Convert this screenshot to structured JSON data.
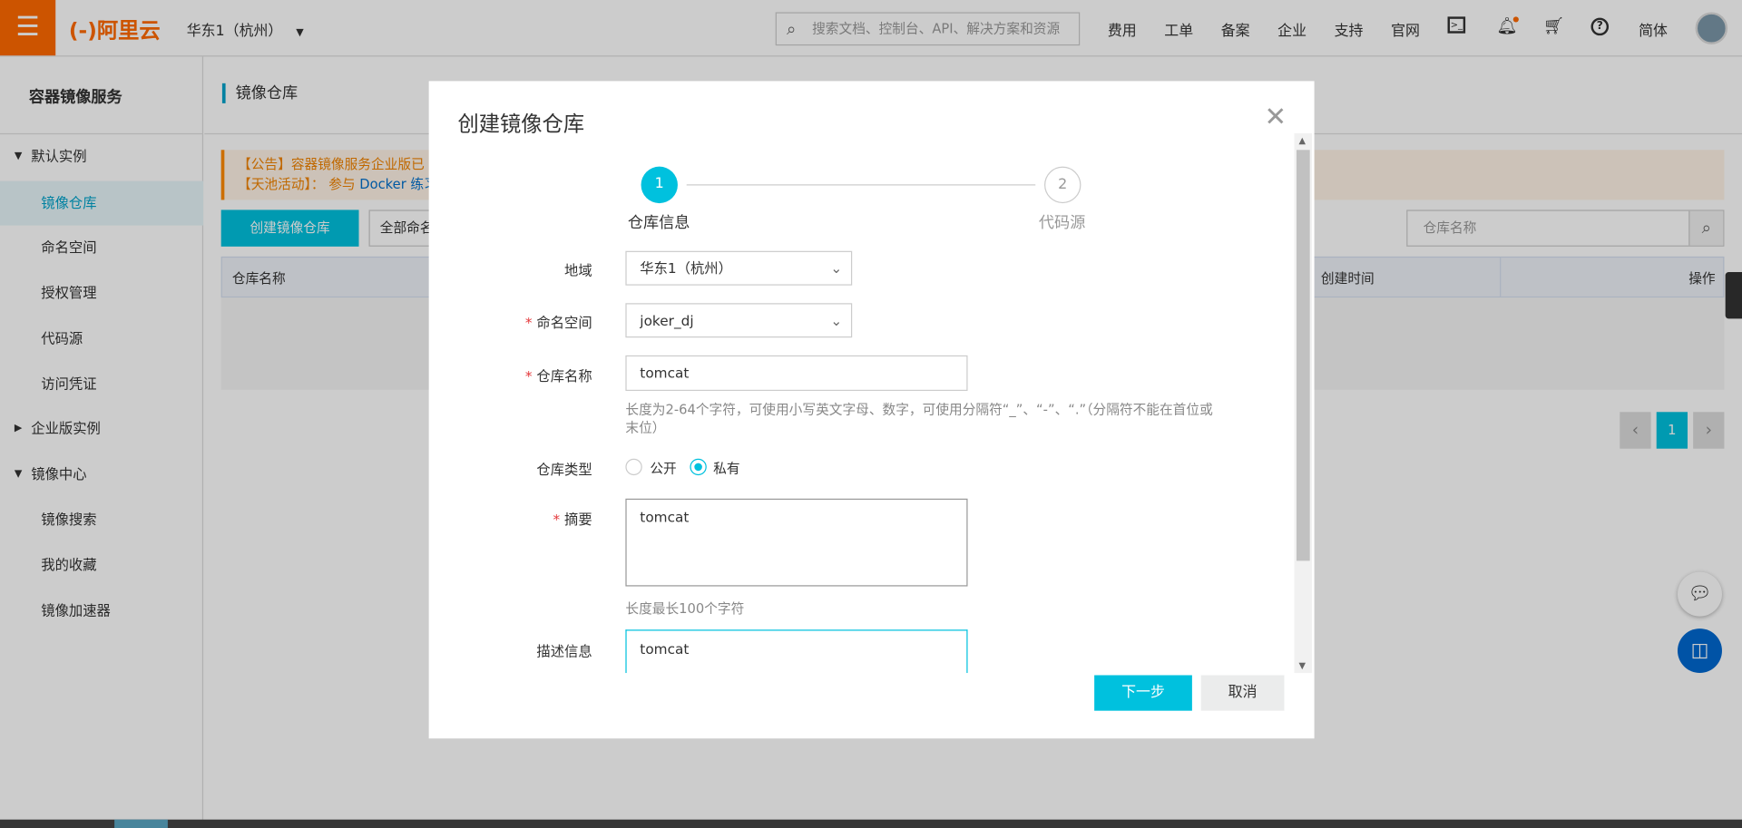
{
  "topbar": {
    "menu_icon": "hamburger-icon",
    "logo": "阿里云",
    "region": "华东1（杭州）",
    "search_placeholder": "搜索文档、控制台、API、解决方案和资源",
    "nav": [
      "费用",
      "工单",
      "备案",
      "企业",
      "支持",
      "官网"
    ],
    "language": "简体",
    "brand_color": "#ff6a00"
  },
  "sidebar": {
    "title": "容器镜像服务",
    "items": [
      {
        "label": "默认实例",
        "type": "group",
        "expanded": true
      },
      {
        "label": "镜像仓库",
        "active": true
      },
      {
        "label": "命名空间"
      },
      {
        "label": "授权管理"
      },
      {
        "label": "代码源"
      },
      {
        "label": "访问凭证"
      },
      {
        "label": "企业版实例",
        "type": "group",
        "expanded": false
      },
      {
        "label": "镜像中心",
        "type": "group",
        "expanded": true
      },
      {
        "label": "镜像搜索"
      },
      {
        "label": "我的收藏"
      },
      {
        "label": "镜像加速器"
      }
    ]
  },
  "main": {
    "title": "镜像仓库",
    "notice1": "【公告】容器镜像服务企业版已",
    "notice2_prefix": "【天池活动】： 参与 ",
    "notice2_link": "Docker 练习",
    "create_button": "创建镜像仓库",
    "namespace_filter": "全部命名",
    "search_placeholder": "仓库名称",
    "columns": [
      "仓库名称",
      "创建时间",
      "操作"
    ],
    "page": "1"
  },
  "modal": {
    "title": "创建镜像仓库",
    "steps": [
      {
        "num": "1",
        "label": "仓库信息",
        "active": true
      },
      {
        "num": "2",
        "label": "代码源",
        "active": false
      }
    ],
    "fields": {
      "region_label": "地域",
      "region_value": "华东1（杭州）",
      "namespace_label": "命名空间",
      "namespace_value": "joker_dj",
      "name_label": "仓库名称",
      "name_value": "tomcat",
      "name_help": "长度为2-64个字符，可使用小写英文字母、数字，可使用分隔符“_”、“-”、“.”（分隔符不能在首位或末位）",
      "type_label": "仓库类型",
      "type_options": [
        "公开",
        "私有"
      ],
      "type_selected": "私有",
      "summary_label": "摘要",
      "summary_value": "tomcat",
      "summary_help": "长度最长100个字符",
      "desc_label": "描述信息",
      "desc_value": "tomcat"
    },
    "required_mark": "*",
    "next_button": "下一步",
    "cancel_button": "取消",
    "accent_color": "#00c1de"
  }
}
